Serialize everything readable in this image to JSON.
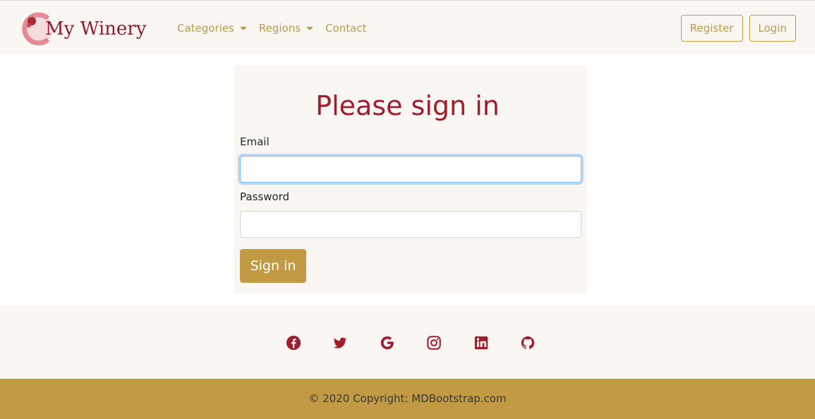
{
  "header": {
    "brand": "My Winery",
    "nav": [
      {
        "label": "Categories",
        "dropdown": true
      },
      {
        "label": "Regions",
        "dropdown": true
      },
      {
        "label": "Contact",
        "dropdown": false
      }
    ],
    "register_label": "Register",
    "login_label": "Login"
  },
  "form": {
    "title": "Please sign in",
    "email_label": "Email",
    "email_value": "",
    "password_label": "Password",
    "password_value": "",
    "submit_label": "Sign in"
  },
  "social": {
    "icons": [
      "facebook-icon",
      "twitter-icon",
      "google-icon",
      "instagram-icon",
      "linkedin-icon",
      "github-icon"
    ],
    "color": "#a01c2e"
  },
  "footer": {
    "copyright": "© 2020 Copyright: MDBootstrap.com"
  },
  "colors": {
    "accent_gold": "#c19a43",
    "brand_red": "#a01c2e",
    "panel_bg": "#faf7f3"
  }
}
